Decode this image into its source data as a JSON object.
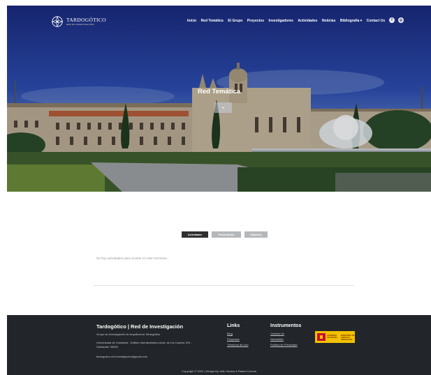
{
  "brand": {
    "title": "TARDOGÓTICO",
    "subtitle": "RED DE INVESTIGACIÓN"
  },
  "nav": {
    "items": [
      "Inicio",
      "Red Temática",
      "El Grupo",
      "Proyectos",
      "Investigadores",
      "Actividades",
      "Noticias",
      "Bibliografía ▾",
      "Contact Us"
    ],
    "social": [
      "f",
      "◎"
    ]
  },
  "hero": {
    "title": "Red Temática"
  },
  "tabs": [
    "Actividades",
    "Presentación",
    "Objetivos"
  ],
  "empty_message": "No hay actividades para mostrar en este momento...",
  "footer": {
    "title": "Tardogótico | Red de Investigación",
    "subtitle": "Grupo de Investigación de Arquitectura Tardogótica",
    "address": "Universidad de Cantabria - Edificio Interfacultativo Avda. de los Castros S/N - Santander 39005",
    "email": "tardogotico.red.investigacion@gmail.com",
    "links_title": "Links",
    "links": [
      "Blog",
      "Proyectos",
      "Términos de Uso"
    ],
    "instr_title": "Instrumentos",
    "instr": [
      "Contact Us",
      "Newsletter",
      "Política de Privacidad"
    ],
    "gov_text_1": "GOBIERNO DE ESPAÑA",
    "gov_text_2": "MINISTERIO DE CIENCIA E INNOVACIÓN",
    "copyright": "Copyright © 2022 | Design By João Santos & Rafael Correia"
  }
}
